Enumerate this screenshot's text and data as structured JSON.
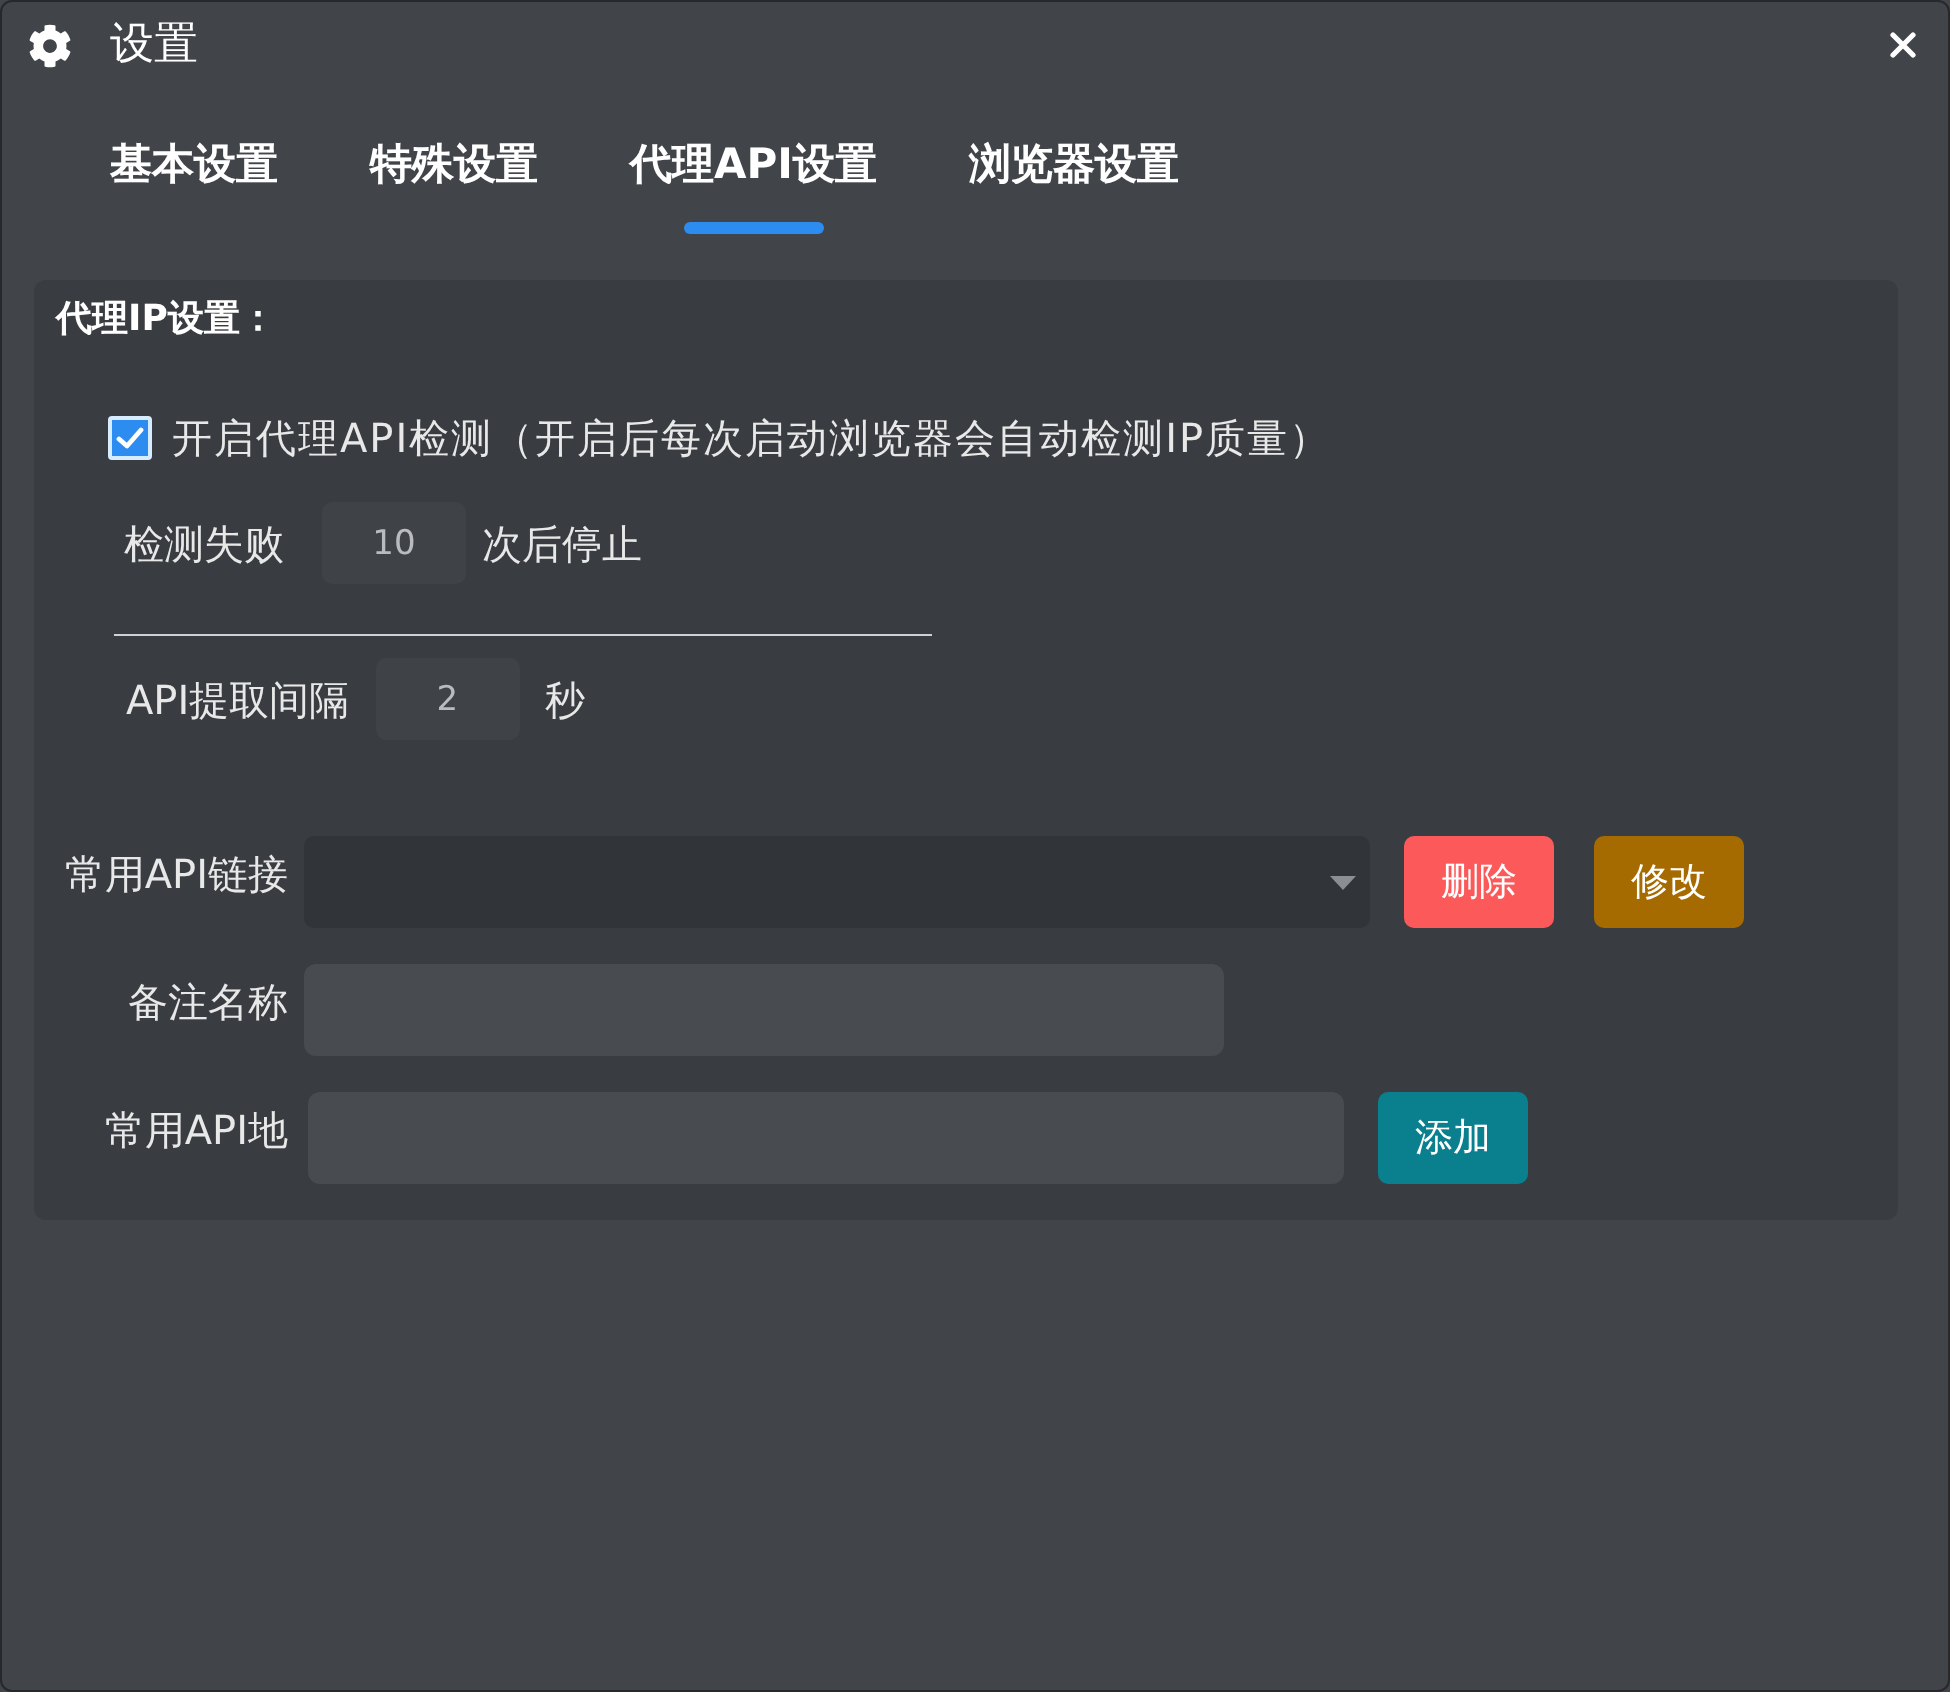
{
  "window": {
    "title": "设置"
  },
  "tabs": [
    {
      "label": "基本设置",
      "selected": false
    },
    {
      "label": "特殊设置",
      "selected": false
    },
    {
      "label": "代理API设置",
      "selected": true
    },
    {
      "label": "浏览器设置",
      "selected": false
    }
  ],
  "proxy_section": {
    "title": "代理IP设置：",
    "api_check": {
      "label": "开启代理API检测（开启后每次启动浏览器会自动检测IP质量）",
      "checked": true
    },
    "fail_limit": {
      "label": "检测失败",
      "value": "10",
      "suffix": "次后停止"
    },
    "interval": {
      "label": "API提取间隔",
      "value": "2",
      "suffix": "秒"
    }
  },
  "api_rows": [
    {
      "label": "常用API链接",
      "kind": "select",
      "buttons": [
        {
          "label": "删除",
          "kind": "danger"
        },
        {
          "label": "修改",
          "kind": "warning"
        }
      ]
    },
    {
      "label": "备注名称",
      "kind": "input"
    },
    {
      "label": "常用API地",
      "kind": "input",
      "buttons": [
        {
          "label": "添加",
          "kind": "primary"
        }
      ]
    }
  ]
}
